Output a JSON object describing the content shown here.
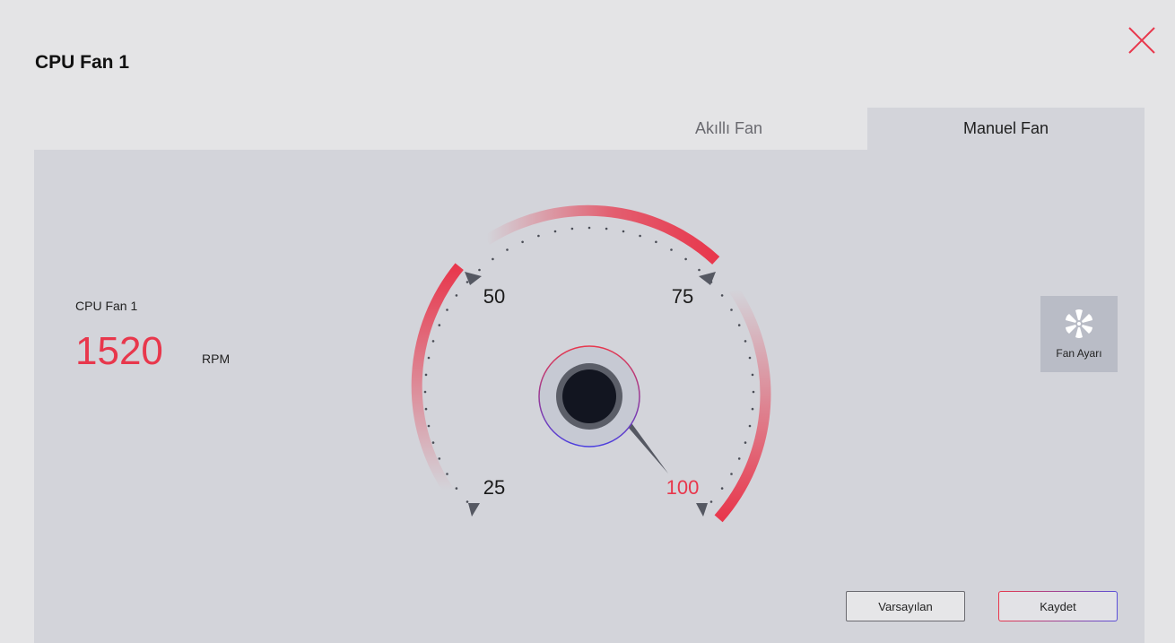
{
  "window": {
    "title": "CPU Fan 1"
  },
  "tabs": [
    {
      "label": "Akıllı Fan",
      "active": false
    },
    {
      "label": "Manuel Fan",
      "active": true
    }
  ],
  "fan": {
    "name": "CPU Fan 1",
    "rpm": "1520",
    "unit": "RPM"
  },
  "gauge": {
    "ticks": [
      "25",
      "50",
      "75",
      "100"
    ],
    "value_percent": 100,
    "active_label": "100"
  },
  "side_button": {
    "label": "Fan Ayarı",
    "icon": "fan-icon"
  },
  "actions": {
    "default_label": "Varsayılan",
    "save_label": "Kaydet"
  },
  "colors": {
    "accent": "#e8374c",
    "accent_blue": "#4a3fe0",
    "panel": "#d3d4da",
    "background": "#e4e4e6"
  }
}
